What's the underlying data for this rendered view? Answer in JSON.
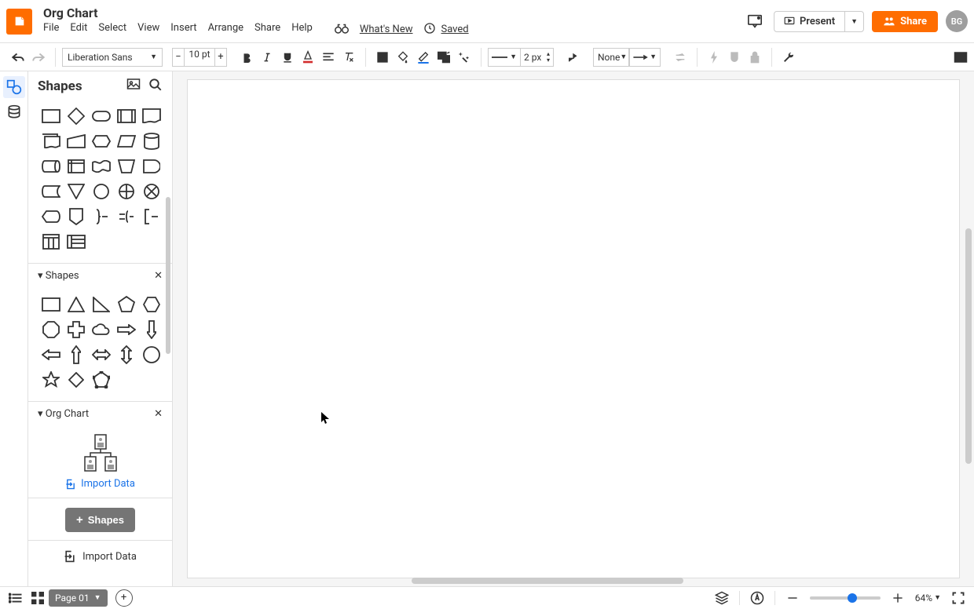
{
  "doc": {
    "title": "Org Chart"
  },
  "menu": {
    "file": "File",
    "edit": "Edit",
    "select": "Select",
    "view": "View",
    "insert": "Insert",
    "arrange": "Arrange",
    "share": "Share",
    "help": "Help",
    "whats_new": "What's New",
    "saved": "Saved"
  },
  "header": {
    "present": "Present",
    "share_btn": "Share",
    "avatar": "BG"
  },
  "toolbar": {
    "font": "Liberation Sans",
    "font_size": "10 pt",
    "line_width": "2 px",
    "endpoint": "None"
  },
  "panel": {
    "title": "Shapes",
    "section_shapes": "Shapes",
    "section_orgchart": "Org Chart",
    "import_data": "Import Data",
    "shapes_button": "Shapes",
    "import_footer": "Import Data"
  },
  "footer": {
    "page": "Page 01",
    "zoom": "64%"
  }
}
